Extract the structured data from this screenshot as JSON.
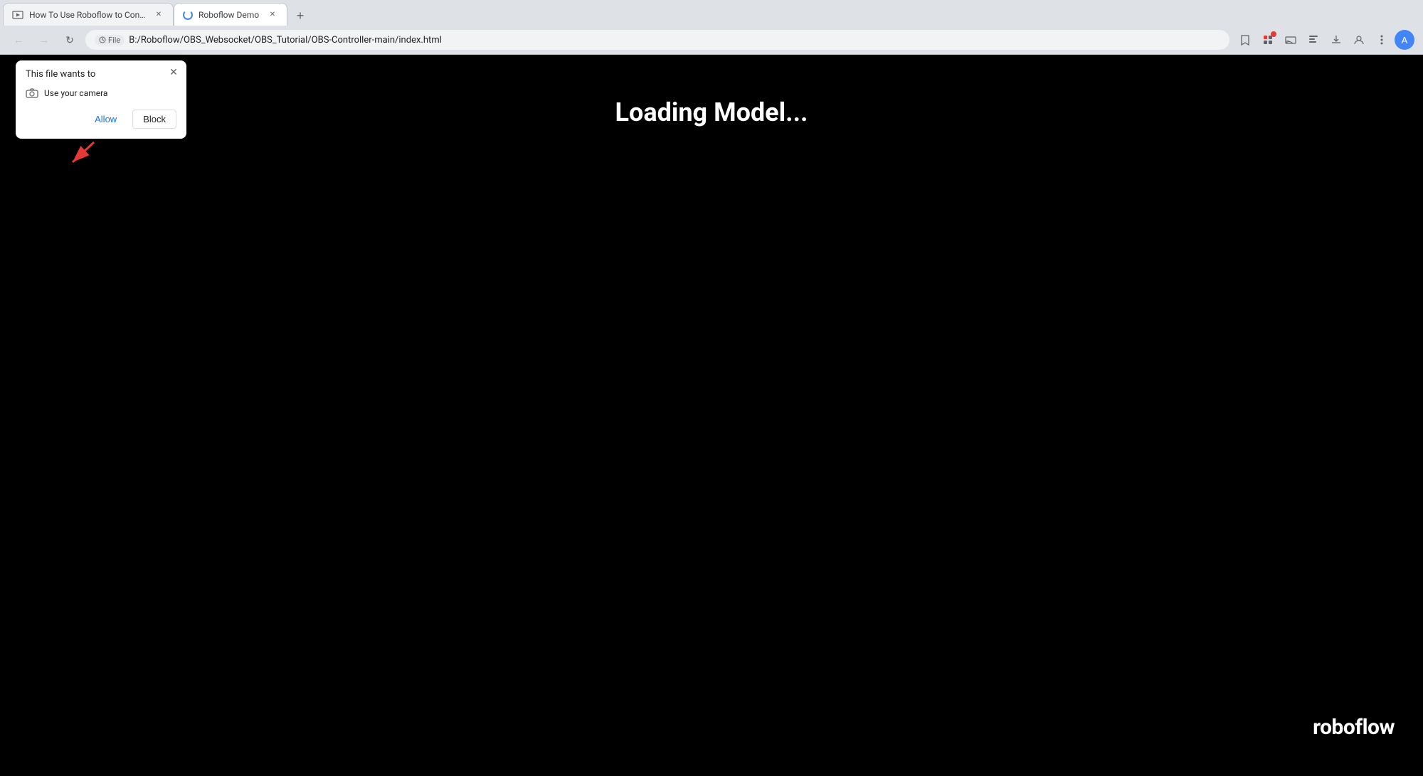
{
  "browser": {
    "tabs": [
      {
        "id": "tab1",
        "title": "How To Use Roboflow to Contr...",
        "active": false,
        "favicon": "video"
      },
      {
        "id": "tab2",
        "title": "Roboflow Demo",
        "active": true,
        "favicon": "spinner"
      }
    ],
    "url_scheme": "File",
    "url_path": "B:/Roboflow/OBS_Websocket/OBS_Tutorial/OBS-Controller-main/index.html",
    "new_tab_label": "+"
  },
  "permission_popup": {
    "title": "This file wants to",
    "permission_label": "Use your camera",
    "allow_label": "Allow",
    "block_label": "Block"
  },
  "page": {
    "loading_text": "Loading Model...",
    "brand": "roboflow"
  }
}
